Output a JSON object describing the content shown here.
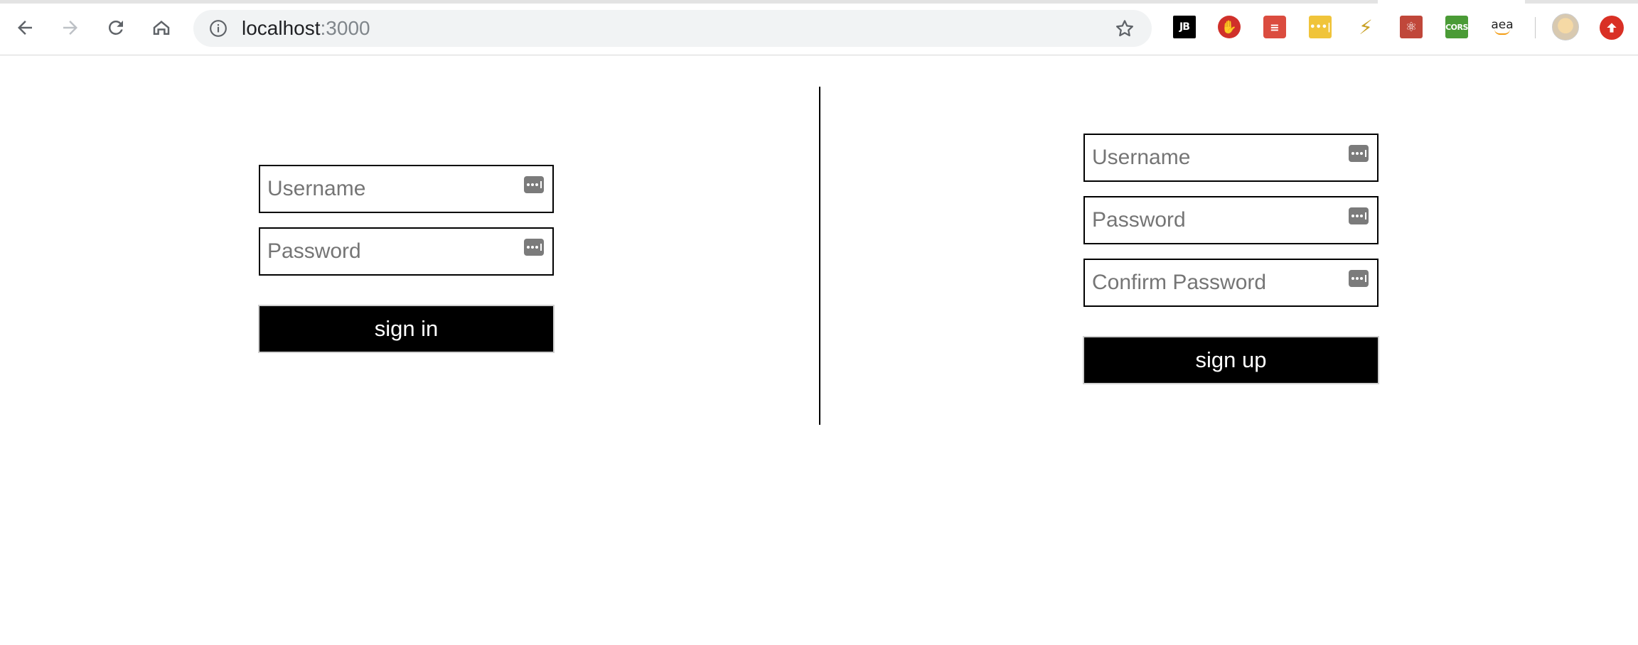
{
  "browser": {
    "url_host": "localhost",
    "url_port": ":3000",
    "extensions": {
      "jetbrains": "JB",
      "adblock": "✋",
      "todoist": "≡",
      "password": "•••|",
      "bolt": "⚡",
      "react": "⚛",
      "cors": "CORS",
      "amazon": "aea"
    }
  },
  "sign_in": {
    "username_placeholder": "Username",
    "password_placeholder": "Password",
    "button_label": "sign in"
  },
  "sign_up": {
    "username_placeholder": "Username",
    "password_placeholder": "Password",
    "confirm_placeholder": "Confirm Password",
    "button_label": "sign up"
  }
}
